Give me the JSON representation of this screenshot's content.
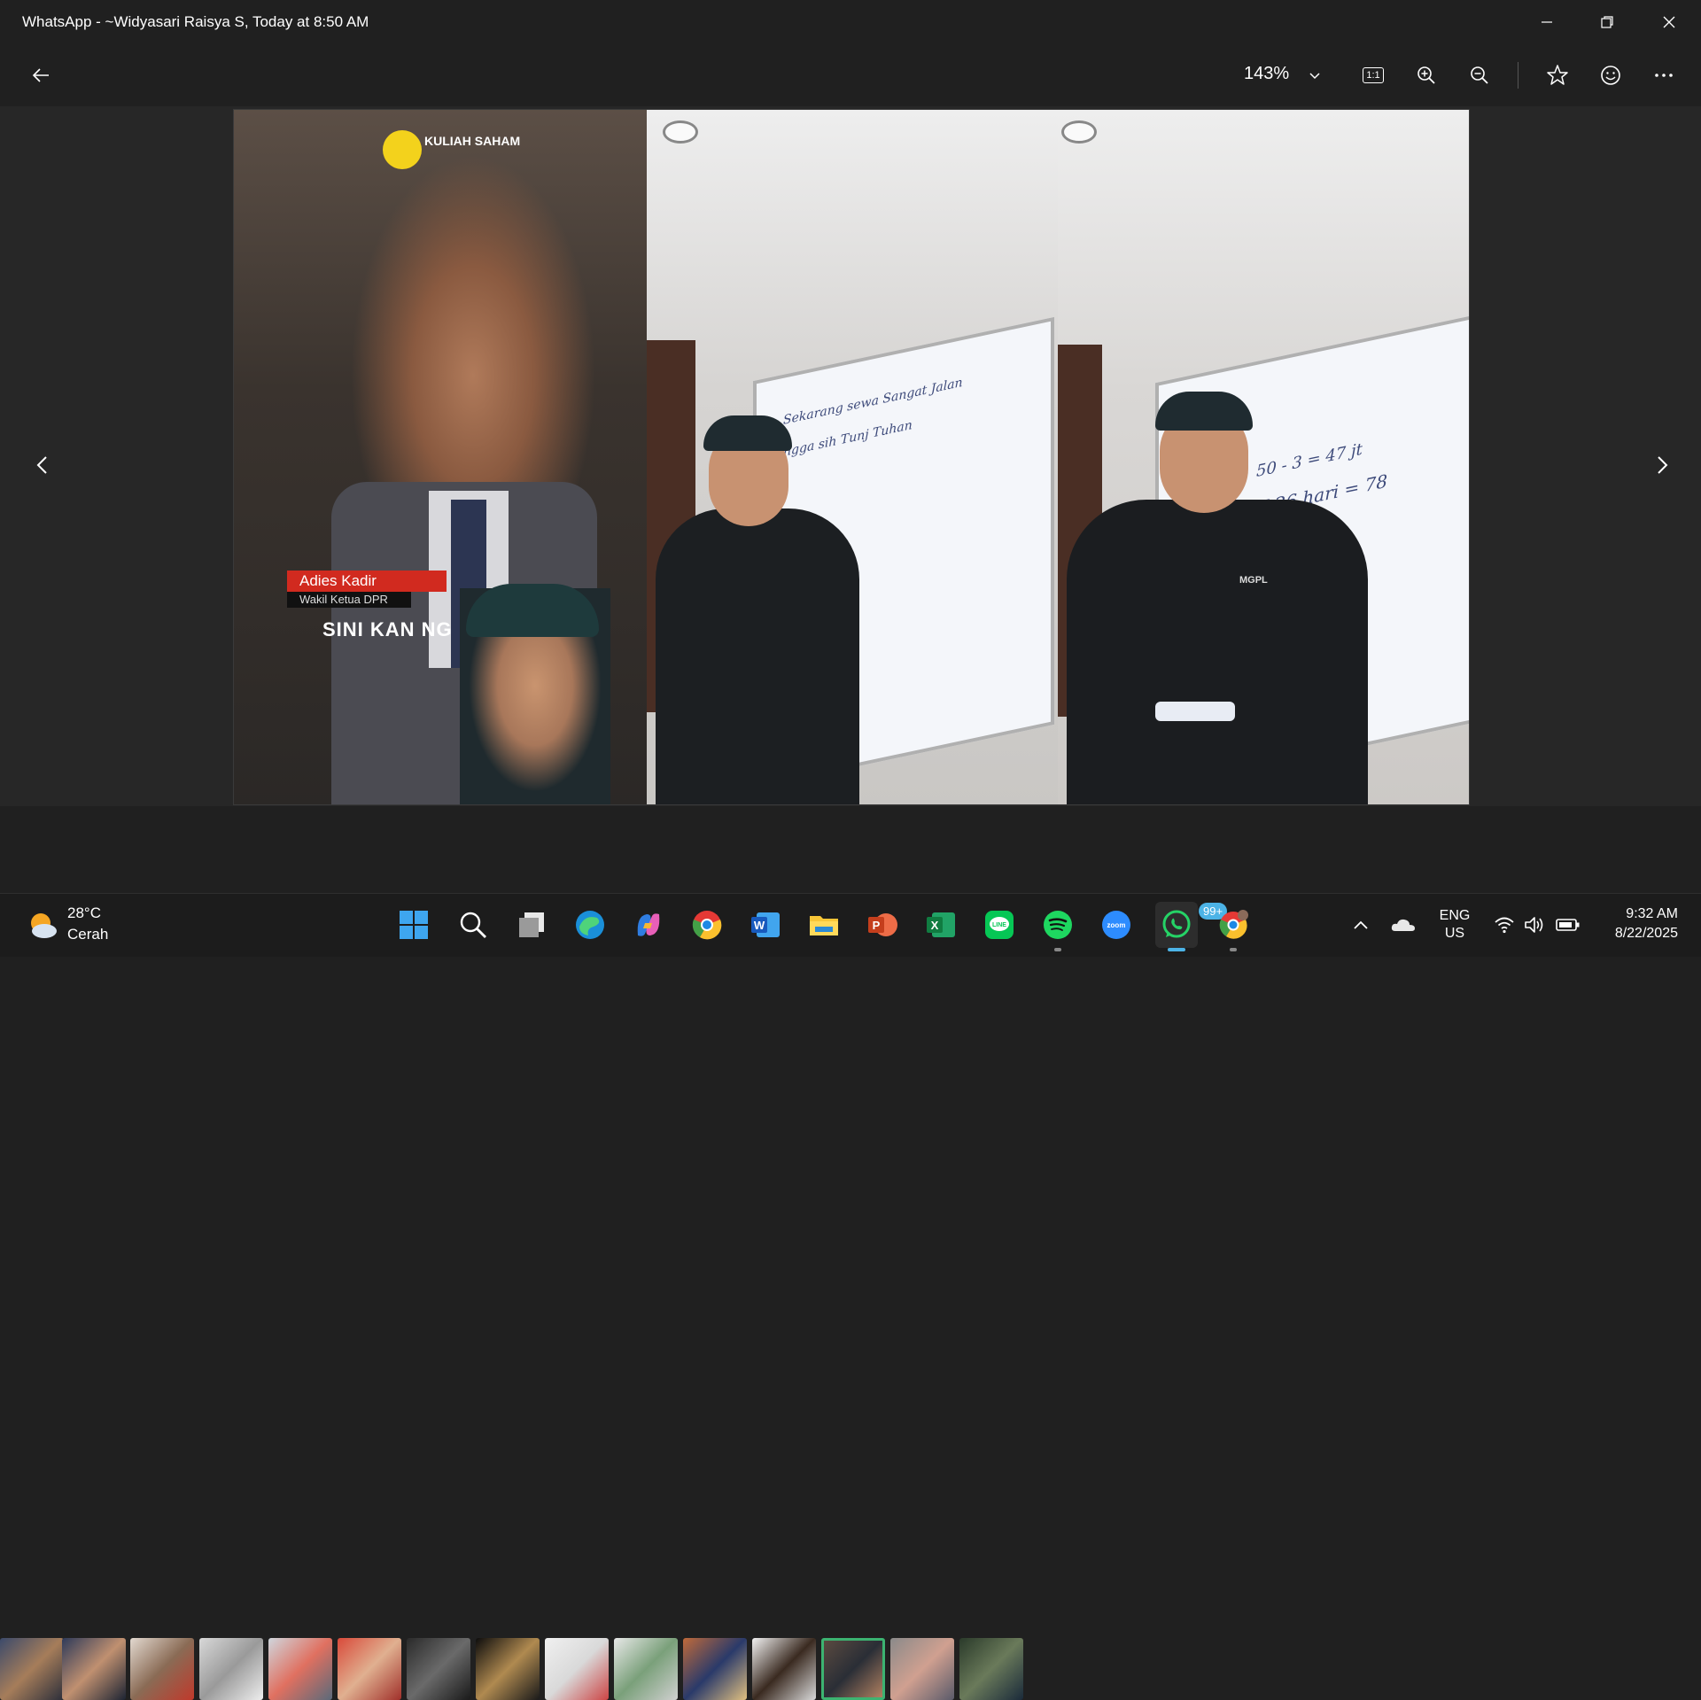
{
  "window": {
    "title": "WhatsApp - ~Widyasari Raisya S, Today at 8:50 AM"
  },
  "toolbar": {
    "zoom_level": "143%",
    "actual_size_label": "1:1"
  },
  "photo": {
    "caption_name": "Adies Kadir",
    "caption_role": "Wakil Ketua DPR",
    "caption_subtitle": "SINI KAN NG",
    "logo_text": "KULIAH SAHAM",
    "whiteboard_line1": "Sekarang sewa  Sangat  Jalan",
    "whiteboard_line2": "ngga sih  Tunj  Tuhan",
    "whiteboard_line3": "50 - 3 = 47 jt",
    "whiteboard_line4": "X 26 hari = 78",
    "shirt_logo": "MGPL"
  },
  "filmstrip": {
    "count": 15,
    "selected_index": 12
  },
  "taskbar": {
    "weather_temp": "28°C",
    "weather_desc": "Cerah",
    "whatsapp_badge": "99+",
    "lang_line1": "ENG",
    "lang_line2": "US",
    "time": "9:32 AM",
    "date": "8/22/2025"
  },
  "colors": {
    "titlebar_bg": "#202020",
    "viewer_bg": "#272727",
    "selected_thumb_border": "#3cb371",
    "badge_bg": "#4cb3e6"
  }
}
